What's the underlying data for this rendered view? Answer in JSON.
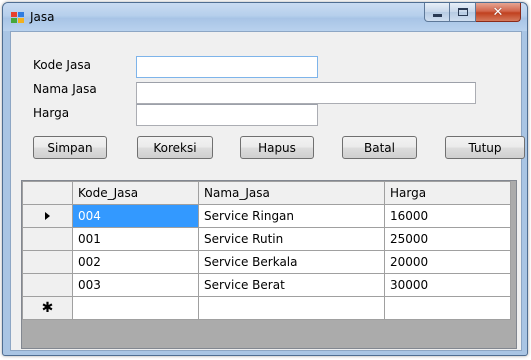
{
  "window": {
    "title": "Jasa",
    "icon": "windows-form-icon",
    "caption_buttons": [
      "minimize",
      "maximize",
      "close"
    ],
    "close_glyph": "✕"
  },
  "form": {
    "fields": [
      {
        "label": "Kode Jasa",
        "value": ""
      },
      {
        "label": "Nama Jasa",
        "value": ""
      },
      {
        "label": "Harga",
        "value": ""
      }
    ],
    "buttons": [
      "Simpan",
      "Koreksi",
      "Hapus",
      "Batal",
      "Tutup"
    ]
  },
  "grid": {
    "columns": [
      "Kode_Jasa",
      "Nama_Jasa",
      "Harga"
    ],
    "rows": [
      {
        "kode": "004",
        "nama": "Service Ringan",
        "harga": "16000"
      },
      {
        "kode": "001",
        "nama": "Service Rutin",
        "harga": "25000"
      },
      {
        "kode": "002",
        "nama": "Service Berkala",
        "harga": "20000"
      },
      {
        "kode": "003",
        "nama": "Service Berat",
        "harga": "30000"
      }
    ],
    "current_row_marker": "▶",
    "new_row_marker": "✱",
    "colors": {
      "selection": "#3399ff",
      "background": "#ababab"
    }
  }
}
